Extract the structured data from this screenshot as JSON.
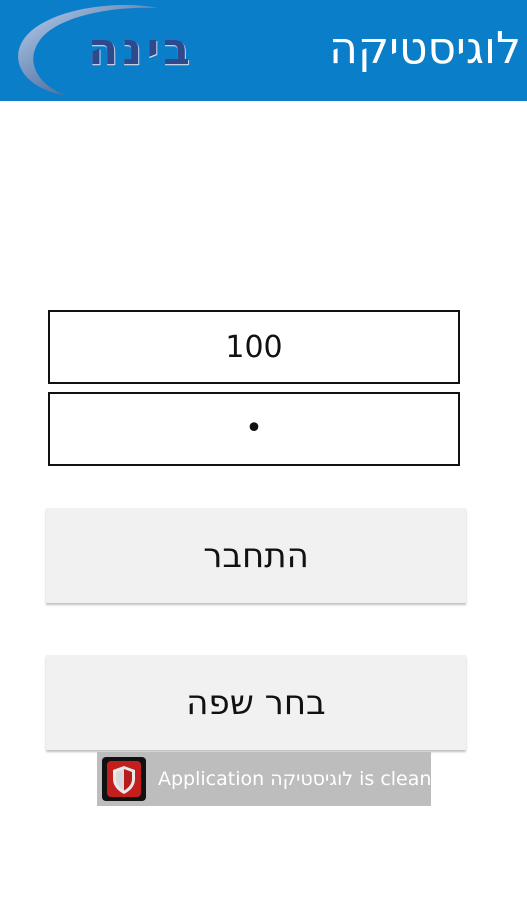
{
  "header": {
    "title": "לוגיסטיקה",
    "logo_text": "בינה",
    "background_color": "#0a7ec8"
  },
  "login_form": {
    "username_value": "100",
    "password_value": "•",
    "login_button_label": "התחבר",
    "language_button_label": "בחר שפה"
  },
  "toast": {
    "icon": "shield-icon",
    "message": "Application לוגיסטיקה is clean"
  }
}
